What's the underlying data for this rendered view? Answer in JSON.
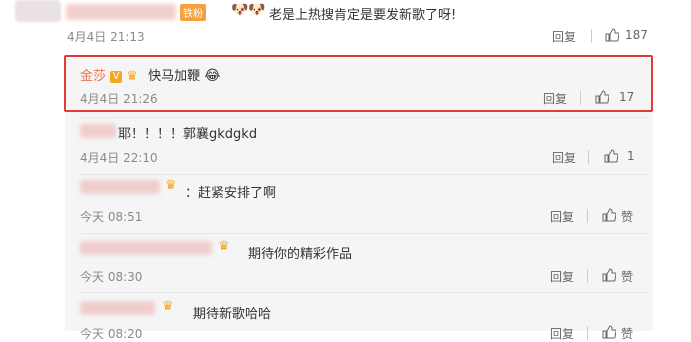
{
  "comments": [
    {
      "id": "top",
      "text": "老是上热搜肯定是要发新歌了呀!",
      "time": "4月4日 21:13",
      "reply": "回复",
      "likes": "187",
      "badge": "铁粉"
    },
    {
      "id": "jinsha",
      "name": "金莎",
      "text": "快马加鞭",
      "time": "4月4日 21:26",
      "reply": "回复",
      "likes": "17"
    },
    {
      "id": "r1",
      "text": "耶！！！！郭襄gkdgkd",
      "time": "4月4日 22:10",
      "reply": "回复",
      "likes": "1"
    },
    {
      "id": "r2",
      "text": "赶紧安排了啊",
      "time": "今天 08:51",
      "reply": "回复",
      "likes": "赞"
    },
    {
      "id": "r3",
      "text": "期待你的精彩作品",
      "time": "今天 08:30",
      "reply": "回复",
      "likes": "赞"
    },
    {
      "id": "r4",
      "text": "期待新歌哈哈",
      "time": "今天 08:20",
      "reply": "回复",
      "likes": "赞"
    }
  ],
  "colors": {
    "accent": "#eb7350",
    "highlight": "#e53935"
  }
}
